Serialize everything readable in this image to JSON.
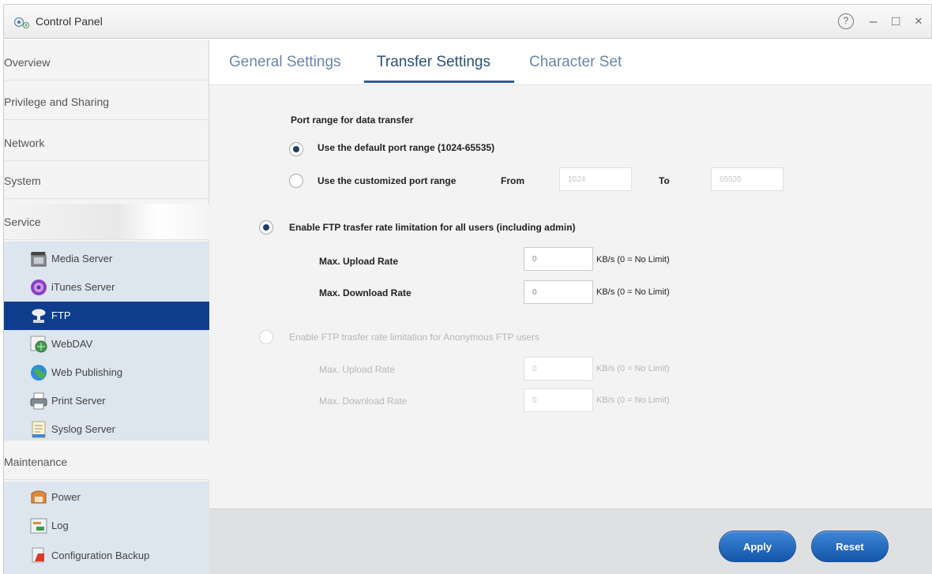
{
  "window": {
    "title": "Control Panel",
    "help_glyph": "?",
    "minimize_glyph": "–",
    "maximize_glyph": "□",
    "close_glyph": "×"
  },
  "sidebar": {
    "categories": {
      "overview": "Overview",
      "privilege": "Privilege and Sharing",
      "network": "Network",
      "system": "System",
      "service": "Service",
      "maintenance": "Maintenance"
    },
    "service_items": [
      {
        "label": "Media Server",
        "icon": "media-server-icon"
      },
      {
        "label": "iTunes Server",
        "icon": "itunes-icon"
      },
      {
        "label": "FTP",
        "icon": "ftp-icon",
        "active": true
      },
      {
        "label": "WebDAV",
        "icon": "webdav-icon"
      },
      {
        "label": "Web Publishing",
        "icon": "web-publishing-icon"
      },
      {
        "label": "Print Server",
        "icon": "printer-icon"
      },
      {
        "label": "Syslog Server",
        "icon": "syslog-icon"
      }
    ],
    "maintenance_items": [
      {
        "label": "Power",
        "icon": "power-icon"
      },
      {
        "label": "Log",
        "icon": "log-icon"
      },
      {
        "label": "Configuration Backup",
        "icon": "backup-icon"
      }
    ]
  },
  "tabs": [
    {
      "label": "General Settings"
    },
    {
      "label": "Transfer Settings",
      "active": true
    },
    {
      "label": "Character Set"
    }
  ],
  "port_range": {
    "heading": "Port range for data transfer",
    "default_option": "Use the default port range (1024-65535)",
    "custom_option": "Use the customized port range",
    "from_label": "From",
    "to_label": "To",
    "from_value": "1024",
    "to_value": "65535",
    "selected": "default"
  },
  "all_users_limit": {
    "label": "Enable FTP trasfer rate limitation for all users (including admin)",
    "enabled": true,
    "upload_label": "Max. Upload Rate",
    "upload_value": "0",
    "upload_unit": "KB/s (0 = No Limit)",
    "download_label": "Max. Download Rate",
    "download_value": "0",
    "download_unit": "KB/s (0 = No Limit)"
  },
  "anon_limit": {
    "label": "Enable FTP trasfer rate limitation for Anonymous FTP users",
    "enabled": false,
    "upload_label": "Max. Upload Rate",
    "upload_value": "0",
    "upload_unit": "KB/s (0 = No Limit)",
    "download_label": "Max. Download Rate",
    "download_value": "0",
    "download_unit": "KB/s (0 = No Limit)"
  },
  "footer": {
    "apply_label": "Apply",
    "reset_label": "Reset"
  },
  "colors": {
    "accent": "#0f3c8c",
    "button": "#1f66bf",
    "tab_active": "#2a4f7a",
    "tab_inactive": "#6a86a8"
  }
}
